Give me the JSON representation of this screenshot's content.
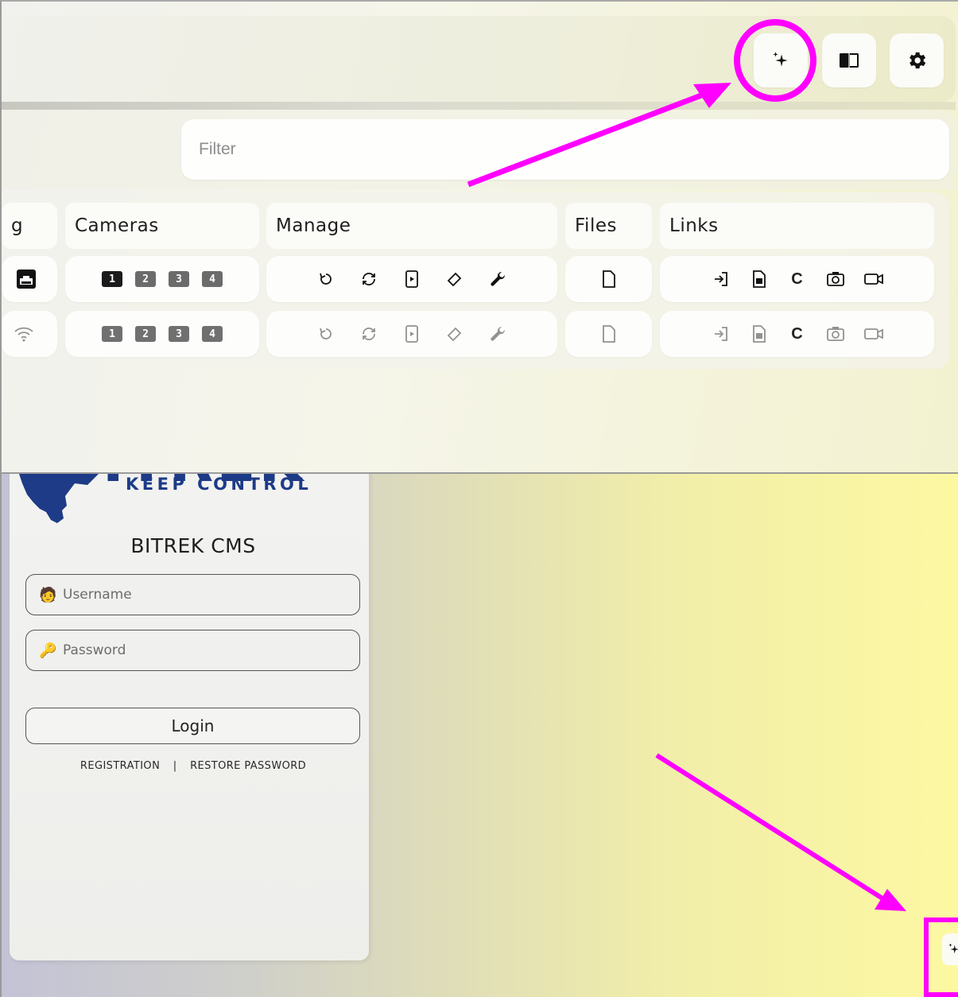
{
  "top": {
    "header_buttons": [
      {
        "name": "sparkles-button",
        "icon": "sparkles-icon"
      },
      {
        "name": "book-button",
        "icon": "book-icon"
      },
      {
        "name": "settings-button",
        "icon": "gear-icon"
      }
    ],
    "filter": {
      "placeholder": "Filter",
      "value": ""
    },
    "columns": [
      "g",
      "Cameras",
      "Manage",
      "Files",
      "Links"
    ],
    "camera_labels": [
      "1",
      "2",
      "3",
      "4"
    ],
    "links_c_label": "C",
    "rows": [
      {
        "status_icon": "ethernet-icon",
        "enabled": true
      },
      {
        "status_icon": "wifi-icon",
        "enabled": false
      }
    ]
  },
  "bottom": {
    "logo_text": "BITREK",
    "tagline": "KEEP CONTROL",
    "title": "BITREK CMS",
    "username": {
      "placeholder": "Username",
      "value": "",
      "icon": "person-emoji"
    },
    "password": {
      "placeholder": "Password",
      "value": "",
      "icon": "key-emoji"
    },
    "username_emoji": "🧑",
    "password_emoji": "🔑",
    "login_label": "Login",
    "registration_label": "REGISTRATION",
    "separator": "|",
    "restore_label": "RESTORE PASSWORD"
  },
  "annotation": {
    "color": "#ff00ff"
  }
}
